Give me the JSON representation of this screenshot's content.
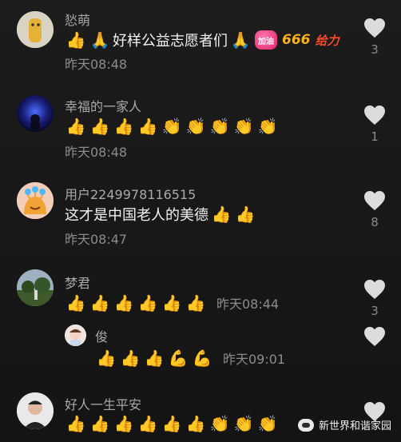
{
  "comments": [
    {
      "name": "悐萌",
      "parts": [
        "👍",
        "🙏",
        "好样公益志愿者们",
        "🙏",
        "加油",
        "666",
        "给力"
      ],
      "time": "昨天08:48",
      "likes": "3"
    },
    {
      "name": "幸福的一家人",
      "parts": [
        "👍",
        "👍",
        "👍",
        "👍",
        "👏",
        "👏",
        "👏",
        "👏",
        "👏"
      ],
      "time": "昨天08:48",
      "likes": "1"
    },
    {
      "name": "用户2249978116515",
      "parts": [
        "这才是中国老人的美德",
        "👍",
        "👍"
      ],
      "time": "昨天08:47",
      "likes": "8"
    },
    {
      "name": "梦君",
      "parts": [
        "👍",
        "👍",
        "👍",
        "👍",
        "👍",
        "👍"
      ],
      "time": "昨天08:44",
      "likes": "3"
    },
    {
      "name": "俊",
      "parts": [
        "👍",
        "👍",
        "👍",
        "💪",
        "💪"
      ],
      "time": "昨天09:01",
      "likes": ""
    },
    {
      "name": "好人一生平安",
      "parts": [
        "👍",
        "👍",
        "👍",
        "👍",
        "👍",
        "👍",
        "👏",
        "👏",
        "👏"
      ],
      "time": "",
      "likes": ""
    }
  ],
  "watermark": {
    "label": "新世界和谐家园"
  },
  "colors": {
    "background": "#161616",
    "text": "#f3f3f3",
    "name": "#a9a9a9",
    "time": "#8c8c8c",
    "heart": "#dcdcdc"
  }
}
